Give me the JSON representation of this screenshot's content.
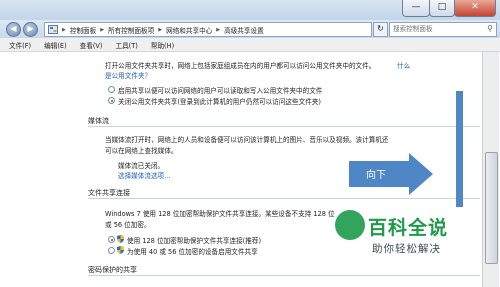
{
  "window": {
    "controls": {
      "minimize": "—",
      "maximize": "□",
      "close": "✕"
    }
  },
  "address": {
    "back": "◀",
    "forward": "▶",
    "refresh": "↻",
    "crumbs": [
      "控制面板",
      "所有控制面板项",
      "网络和共享中心",
      "高级共享设置"
    ],
    "separator": "▶",
    "search_placeholder": "搜索控制面板"
  },
  "menu": [
    "文件(F)",
    "编辑(E)",
    "查看(V)",
    "工具(T)",
    "帮助(H)"
  ],
  "public_folder": {
    "desc_line1": "打开公用文件夹共享时，网络上包括家庭组成员在内的用户都可以访问公用文件夹中的文件。",
    "desc_link_inline": "什么",
    "desc_link": "是公用文件夹？",
    "options": [
      {
        "label": "启用共享以便可以访问网络的用户可以读取和写入公用文件夹中的文件",
        "selected": false
      },
      {
        "label": "关闭公用文件夹共享(登录到此计算机的用户仍然可以访问这些文件夹)",
        "selected": true
      }
    ]
  },
  "media": {
    "heading": "媒体流",
    "desc_line1": "当媒体流打开时，网络上的人员和设备便可以访问该计算机上的图片、音乐以及视频。该计算机还",
    "desc_line2": "可以在网络上查找媒体。",
    "status": "媒体流已关闭。",
    "link": "选择媒体流选项..."
  },
  "file_sharing": {
    "heading": "文件共享连接",
    "desc_line1": "Windows 7 使用 128 位加密帮助保护文件共享连接。某些设备不支持 128 位",
    "desc_line2": "或 56 位加密。",
    "options": [
      {
        "label": "使用 128 位加密帮助保护文件共享连接(推荐)",
        "selected": true
      },
      {
        "label": "为使用 40 或 56 位加密的设备启用文件共享",
        "selected": false
      }
    ]
  },
  "password": {
    "heading": "密码保护的共享"
  },
  "overlay": {
    "arrow_label": "向下",
    "watermark_title": "百科全说",
    "watermark_subtitle": "助你轻松解决"
  }
}
